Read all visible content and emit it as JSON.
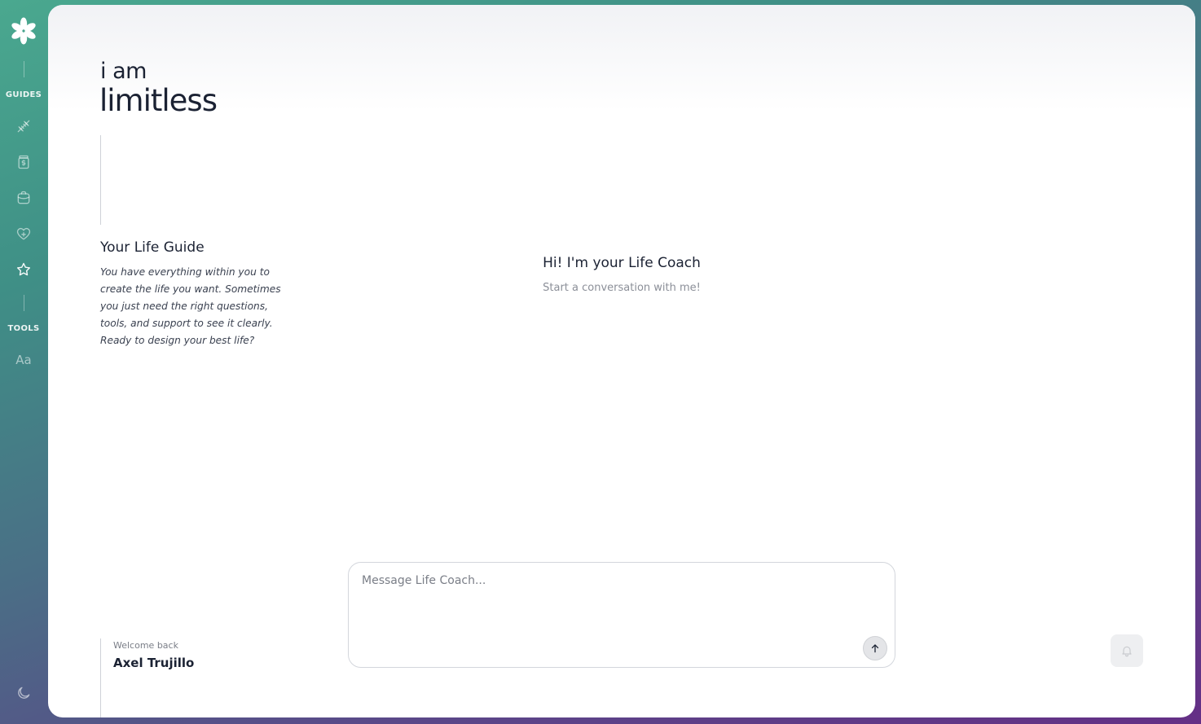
{
  "sidebar": {
    "guides_label": "GUIDES",
    "tools_label": "TOOLS",
    "guide_icons": [
      "fitness-icon",
      "finance-jar-icon",
      "career-briefcase-icon",
      "health-heart-icon",
      "life-star-icon"
    ],
    "tool_icons": [
      "font-text-icon"
    ],
    "font_tool_glyph": "Aa",
    "theme_icon": "moon-icon"
  },
  "brand": {
    "line1": "i am",
    "line2": "limitless"
  },
  "guide": {
    "title": "Your Life Guide",
    "description": "You have everything within you to create the life you want. Sometimes you just need the right questions, tools, and support to see it clearly. Ready to design your best life?"
  },
  "chat": {
    "title": "Hi! I'm your Life Coach",
    "subtitle": "Start a conversation with me!",
    "input_placeholder": "Message Life Coach...",
    "send_icon": "arrow-up-icon"
  },
  "user": {
    "welcome_label": "Welcome back",
    "name": "Axel Trujillo"
  },
  "colors": {
    "accent_gradient_start": "#4aa88f",
    "accent_gradient_end": "#642f86",
    "text_primary": "#1b2233",
    "text_muted": "#8b8f98"
  }
}
